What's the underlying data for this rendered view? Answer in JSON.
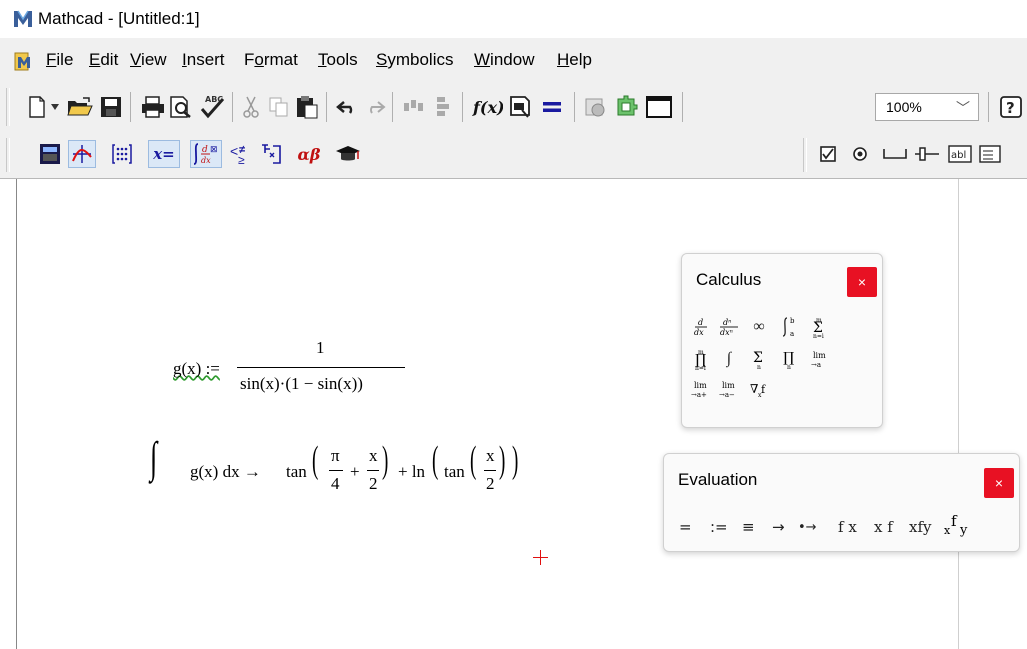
{
  "window": {
    "title": "Mathcad - [Untitled:1]"
  },
  "menu": [
    {
      "label": "File",
      "key": "F",
      "rest": "ile"
    },
    {
      "label": "Edit",
      "key": "E",
      "rest": "dit"
    },
    {
      "label": "View",
      "key": "V",
      "rest": "iew"
    },
    {
      "label": "Insert",
      "key": "I",
      "rest": "nsert"
    },
    {
      "label": "Format",
      "key": "F",
      "rest": "ormat",
      "pre": "F",
      "mid": "o",
      "post": "rmat"
    },
    {
      "label": "Tools",
      "key": "T",
      "rest": "ools"
    },
    {
      "label": "Symbolics",
      "key": "S",
      "rest": "ymbolics"
    },
    {
      "label": "Window",
      "key": "W",
      "rest": "indow"
    },
    {
      "label": "Help",
      "key": "H",
      "rest": "elp"
    }
  ],
  "toolbar": {
    "zoom_value": "100%",
    "xeq_label": "x=",
    "alphabeta_label": "αβ",
    "fx_label": "f(x)",
    "checkbox_label": "☑",
    "textbox_label": "abl"
  },
  "document": {
    "eq1": {
      "lhs": "g(x) :=",
      "num": "1",
      "den": "sin(x)·(1 − sin(x))"
    },
    "eq2": {
      "integral": "∫",
      "integrand": "g(x) dx →",
      "tan": "tan",
      "pi": "π",
      "four": "4",
      "plus": "+",
      "x": "x",
      "two": "2",
      "ln": "+ ln",
      "tan2": "tan"
    }
  },
  "calculus_panel": {
    "title": "Calculus",
    "close": "×",
    "buttons": [
      "d/dx",
      "dⁿ/dxⁿ",
      "∞",
      "∫ₐᵇ",
      "Σ",
      "∏",
      "∫",
      "Σ",
      "∏",
      "lim",
      "lim₊",
      "lim₋",
      "∇ₓf"
    ]
  },
  "evaluation_panel": {
    "title": "Evaluation",
    "close": "×",
    "buttons": [
      "=",
      ":=",
      "≡",
      "→",
      "•→",
      "f x",
      "x f",
      "xfy",
      "xfy"
    ]
  }
}
